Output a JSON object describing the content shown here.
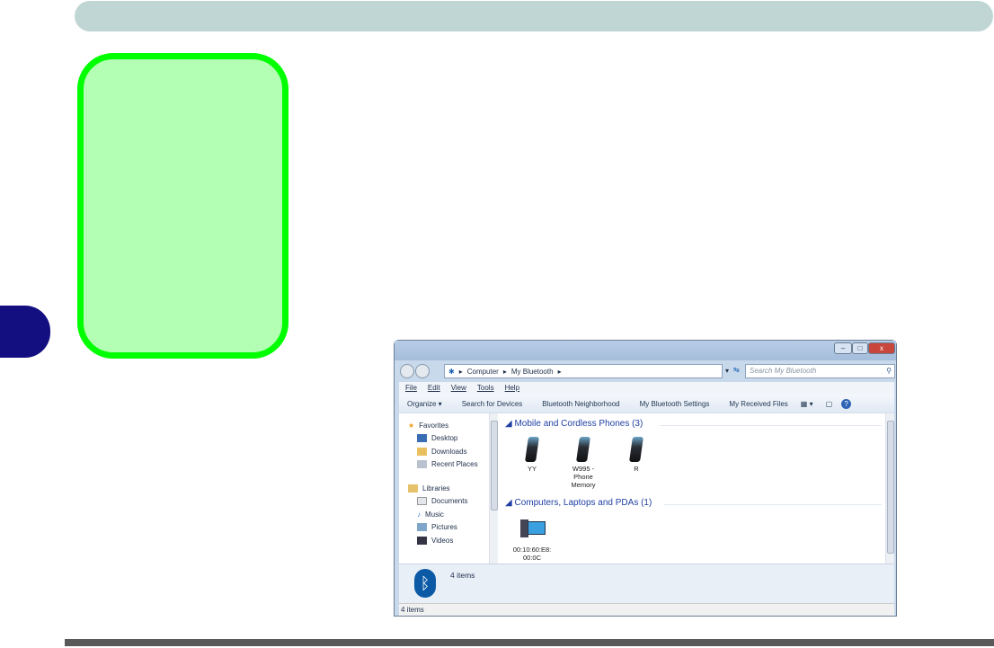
{
  "window": {
    "controls": {
      "minimize": "–",
      "maximize": "□",
      "close": "x"
    },
    "breadcrumb": [
      "Computer",
      "My Bluetooth"
    ],
    "search_placeholder": "Search My Bluetooth",
    "menu": [
      "File",
      "Edit",
      "View",
      "Tools",
      "Help"
    ],
    "toolbar": [
      "Organize ▾",
      "Search for Devices",
      "Bluetooth Neighborhood",
      "My Bluetooth Settings",
      "My Received Files"
    ],
    "sidebar": {
      "favorites": "Favorites",
      "fav_items": [
        "Desktop",
        "Downloads",
        "Recent Places"
      ],
      "libraries": "Libraries",
      "lib_items": [
        "Documents",
        "Music",
        "Pictures",
        "Videos"
      ]
    },
    "groups": [
      {
        "title": "Mobile and Cordless Phones (3)",
        "devices": [
          "YY",
          "W995 - Phone Memory",
          "R"
        ]
      },
      {
        "title": "Computers, Laptops and PDAs (1)",
        "devices": [
          "00:10:60:E8: 00:0C"
        ]
      }
    ],
    "details_count": "4 items",
    "status": "4 items"
  },
  "colors": {
    "header": "#c0d6d4",
    "tab": "#140f80",
    "note_border": "#00ff00",
    "note_fill": "#b3ffb3"
  }
}
